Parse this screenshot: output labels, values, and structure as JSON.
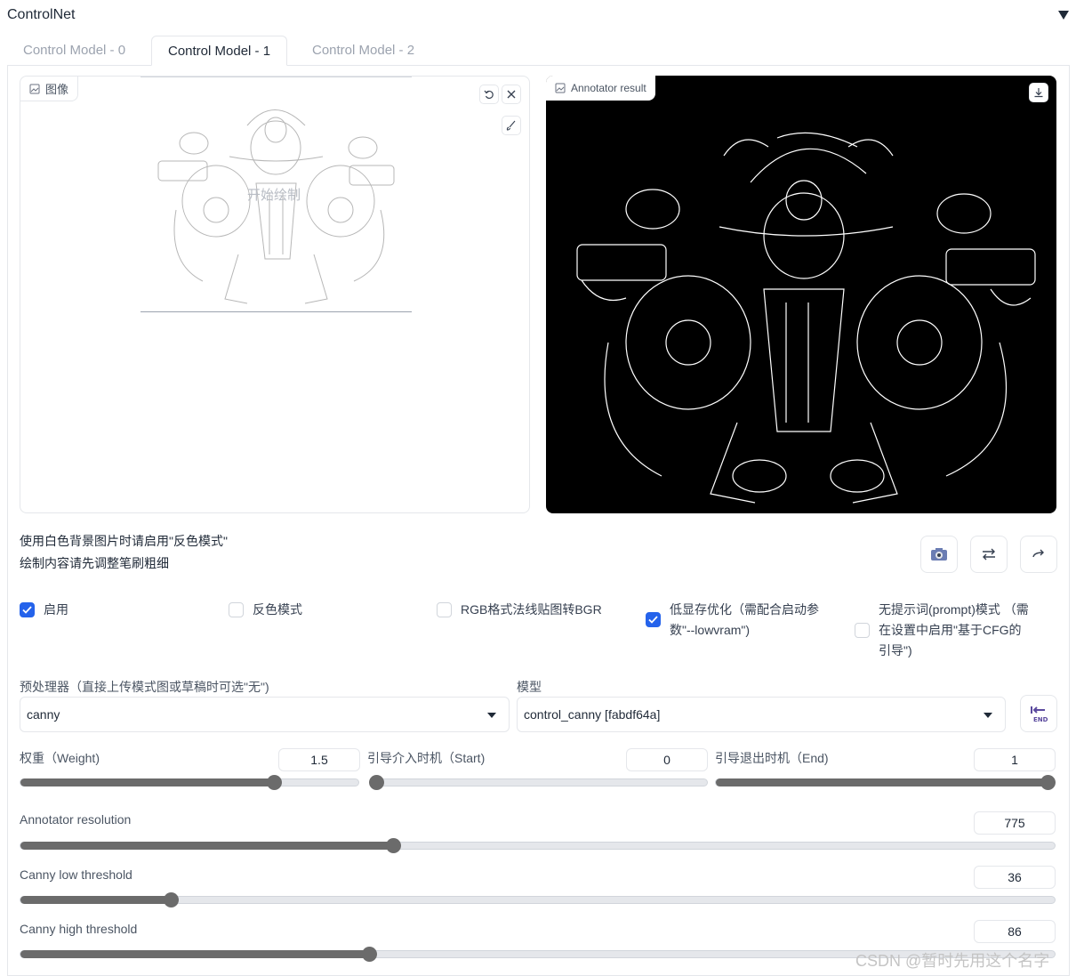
{
  "header": {
    "title": "ControlNet"
  },
  "tabs": [
    {
      "label": "Control Model - 0",
      "active": false
    },
    {
      "label": "Control Model - 1",
      "active": true
    },
    {
      "label": "Control Model - 2",
      "active": false
    }
  ],
  "image_panel": {
    "label": "图像",
    "hint": "开始绘制"
  },
  "annotator_panel": {
    "label": "Annotator result"
  },
  "hints": {
    "line1": "使用白色背景图片时请启用\"反色模式\"",
    "line2": "绘制内容请先调整笔刷粗细"
  },
  "checkboxes": {
    "enable": {
      "label": "启用",
      "checked": true
    },
    "invert": {
      "label": "反色模式",
      "checked": false
    },
    "rgb_bgr": {
      "label": "RGB格式法线贴图转BGR",
      "checked": false
    },
    "lowvram": {
      "label": "低显存优化（需配合启动参数\"--lowvram\")",
      "checked": true
    },
    "guess_mode": {
      "label": "无提示词(prompt)模式 （需在设置中启用\"基于CFG的引导\")",
      "checked": false
    }
  },
  "preprocessor": {
    "label": "预处理器（直接上传模式图或草稿时可选\"无\")",
    "value": "canny"
  },
  "model": {
    "label": "模型",
    "value": "control_canny [fabdf64a]"
  },
  "sliders": {
    "weight": {
      "label": "权重（Weight)",
      "value": "1.5",
      "fraction": 0.75
    },
    "start": {
      "label": "引导介入时机（Start)",
      "value": "0",
      "fraction": 0.0
    },
    "end": {
      "label": "引导退出时机（End)",
      "value": "1",
      "fraction": 1.0
    },
    "annotator_resolution": {
      "label": "Annotator resolution",
      "value": "775",
      "fraction": 0.36
    },
    "canny_low": {
      "label": "Canny low threshold",
      "value": "36",
      "fraction": 0.145
    },
    "canny_high": {
      "label": "Canny high threshold",
      "value": "86",
      "fraction": 0.337
    }
  },
  "watermark": "CSDN @暂时先用这个名字",
  "colors": {
    "accent": "#2563eb",
    "slider": "#6b6b6b"
  }
}
